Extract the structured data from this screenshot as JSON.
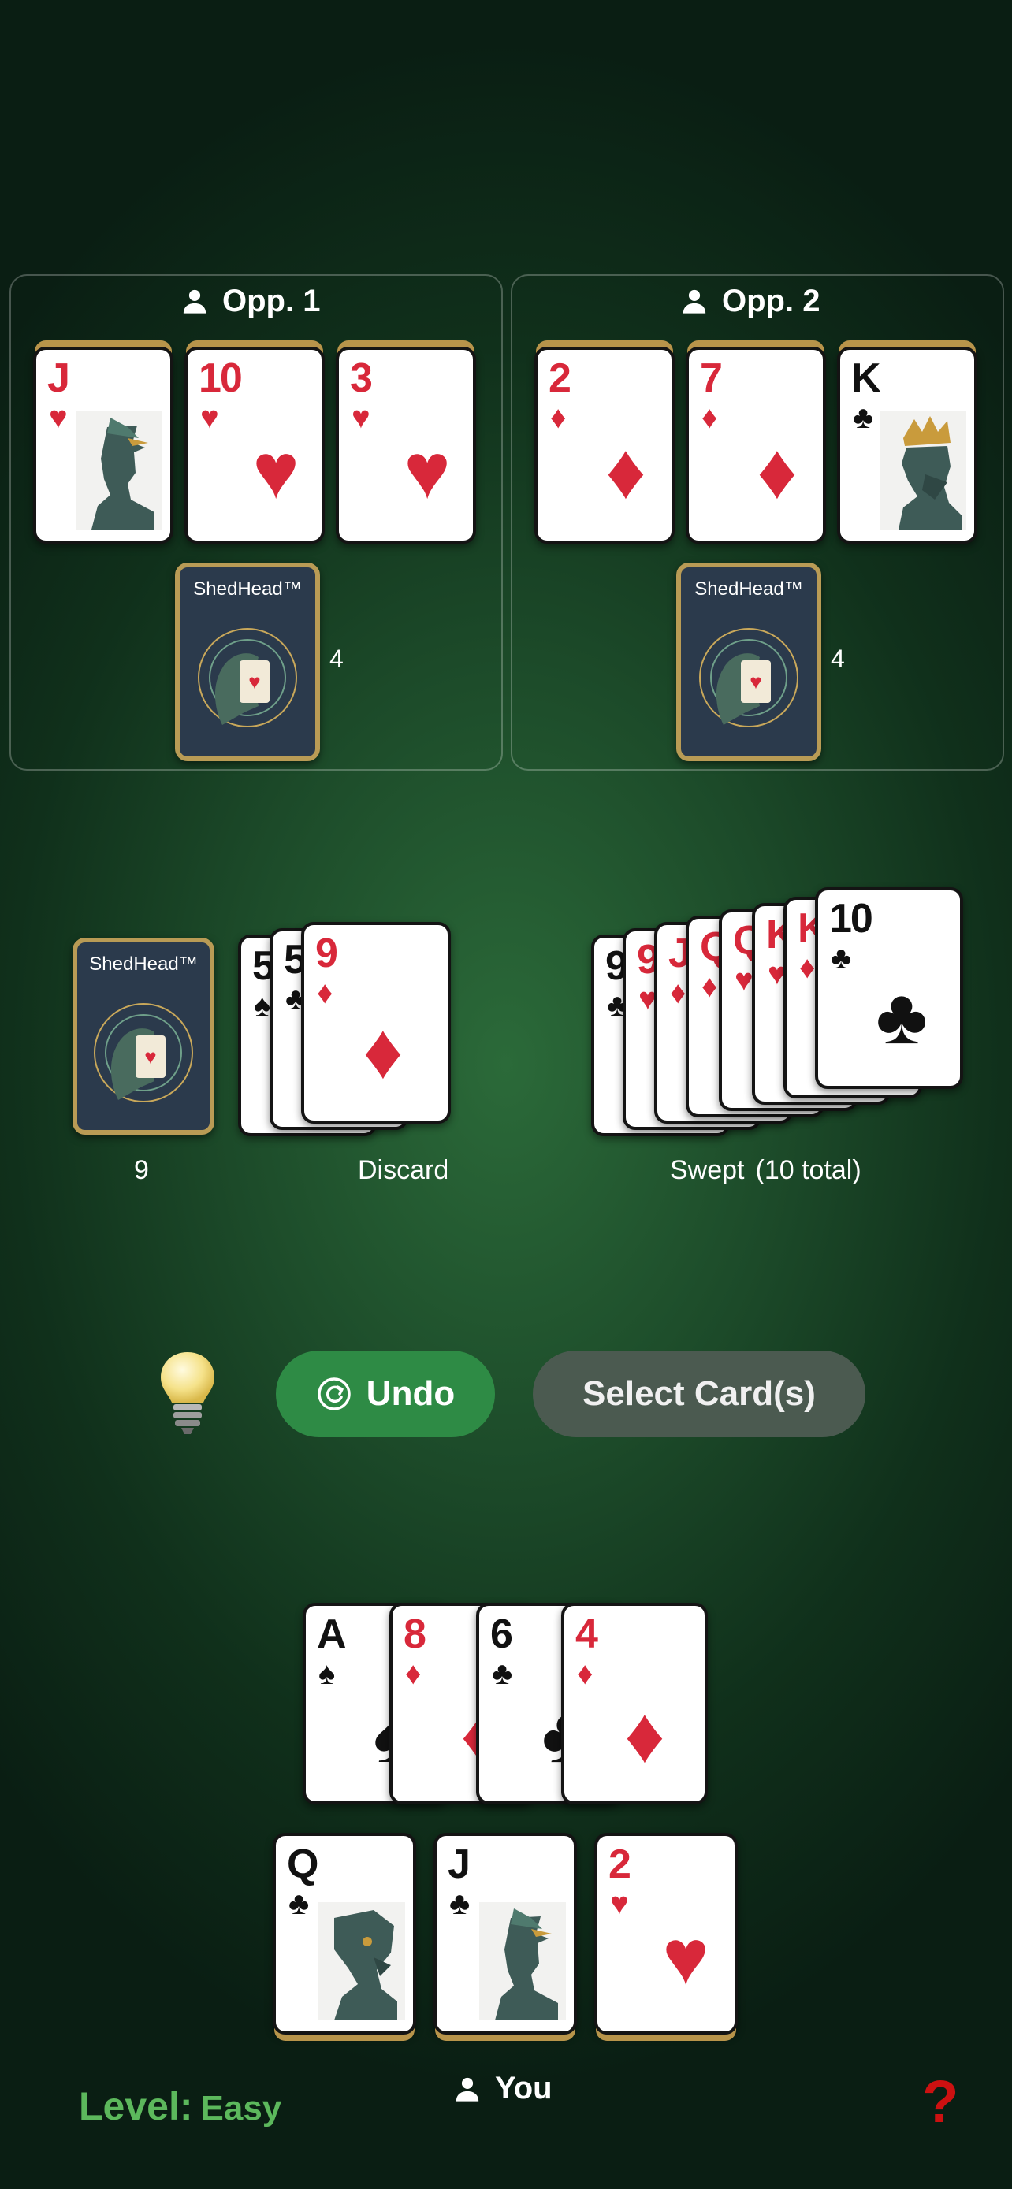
{
  "opponents": [
    {
      "name": "Opp. 1",
      "face_up": [
        {
          "rank": "J",
          "suit": "♥",
          "color": "red",
          "face": true
        },
        {
          "rank": "10",
          "suit": "♥",
          "color": "red",
          "face": false
        },
        {
          "rank": "3",
          "suit": "♥",
          "color": "red",
          "face": false
        }
      ],
      "hand_count": "4",
      "back_title": "ShedHead™"
    },
    {
      "name": "Opp. 2",
      "face_up": [
        {
          "rank": "2",
          "suit": "♦",
          "color": "red",
          "face": false
        },
        {
          "rank": "7",
          "suit": "♦",
          "color": "red",
          "face": false
        },
        {
          "rank": "K",
          "suit": "♣",
          "color": "black",
          "face": true
        }
      ],
      "hand_count": "4",
      "back_title": "ShedHead™"
    }
  ],
  "deck": {
    "back_title": "ShedHead™",
    "count": "9"
  },
  "discard": {
    "label": "Discard",
    "cards": [
      {
        "rank": "5",
        "suit": "♠",
        "color": "black"
      },
      {
        "rank": "5",
        "suit": "♣",
        "color": "black"
      },
      {
        "rank": "9",
        "suit": "♦",
        "color": "red"
      }
    ]
  },
  "swept": {
    "label": "Swept",
    "total_label": "(10 total)",
    "cards": [
      {
        "rank": "9",
        "suit": "♣",
        "color": "black"
      },
      {
        "rank": "9",
        "suit": "♥",
        "color": "red"
      },
      {
        "rank": "J",
        "suit": "♦",
        "color": "red"
      },
      {
        "rank": "Q",
        "suit": "♦",
        "color": "red"
      },
      {
        "rank": "Q",
        "suit": "♥",
        "color": "red"
      },
      {
        "rank": "K",
        "suit": "♥",
        "color": "red"
      },
      {
        "rank": "K",
        "suit": "♦",
        "color": "red"
      },
      {
        "rank": "10",
        "suit": "♣",
        "color": "black"
      }
    ]
  },
  "controls": {
    "undo_label": "Undo",
    "select_label": "Select Card(s)",
    "hint_icon": "lightbulb-icon"
  },
  "player": {
    "name": "You",
    "hand": [
      {
        "rank": "A",
        "suit": "♠",
        "color": "black"
      },
      {
        "rank": "8",
        "suit": "♦",
        "color": "red"
      },
      {
        "rank": "6",
        "suit": "♣",
        "color": "black"
      },
      {
        "rank": "4",
        "suit": "♦",
        "color": "red"
      }
    ],
    "face_up": [
      {
        "rank": "Q",
        "suit": "♣",
        "color": "black",
        "face": true
      },
      {
        "rank": "J",
        "suit": "♣",
        "color": "black",
        "face": true
      },
      {
        "rank": "2",
        "suit": "♥",
        "color": "red",
        "face": false
      }
    ]
  },
  "level": {
    "label": "Level:",
    "value": "Easy"
  },
  "help_icon": "?",
  "colors": {
    "accent_green": "#2e8b45",
    "level_green": "#5cb85c",
    "card_red": "#d8283a",
    "help_red": "#cc1111",
    "gold": "#b99b55"
  }
}
